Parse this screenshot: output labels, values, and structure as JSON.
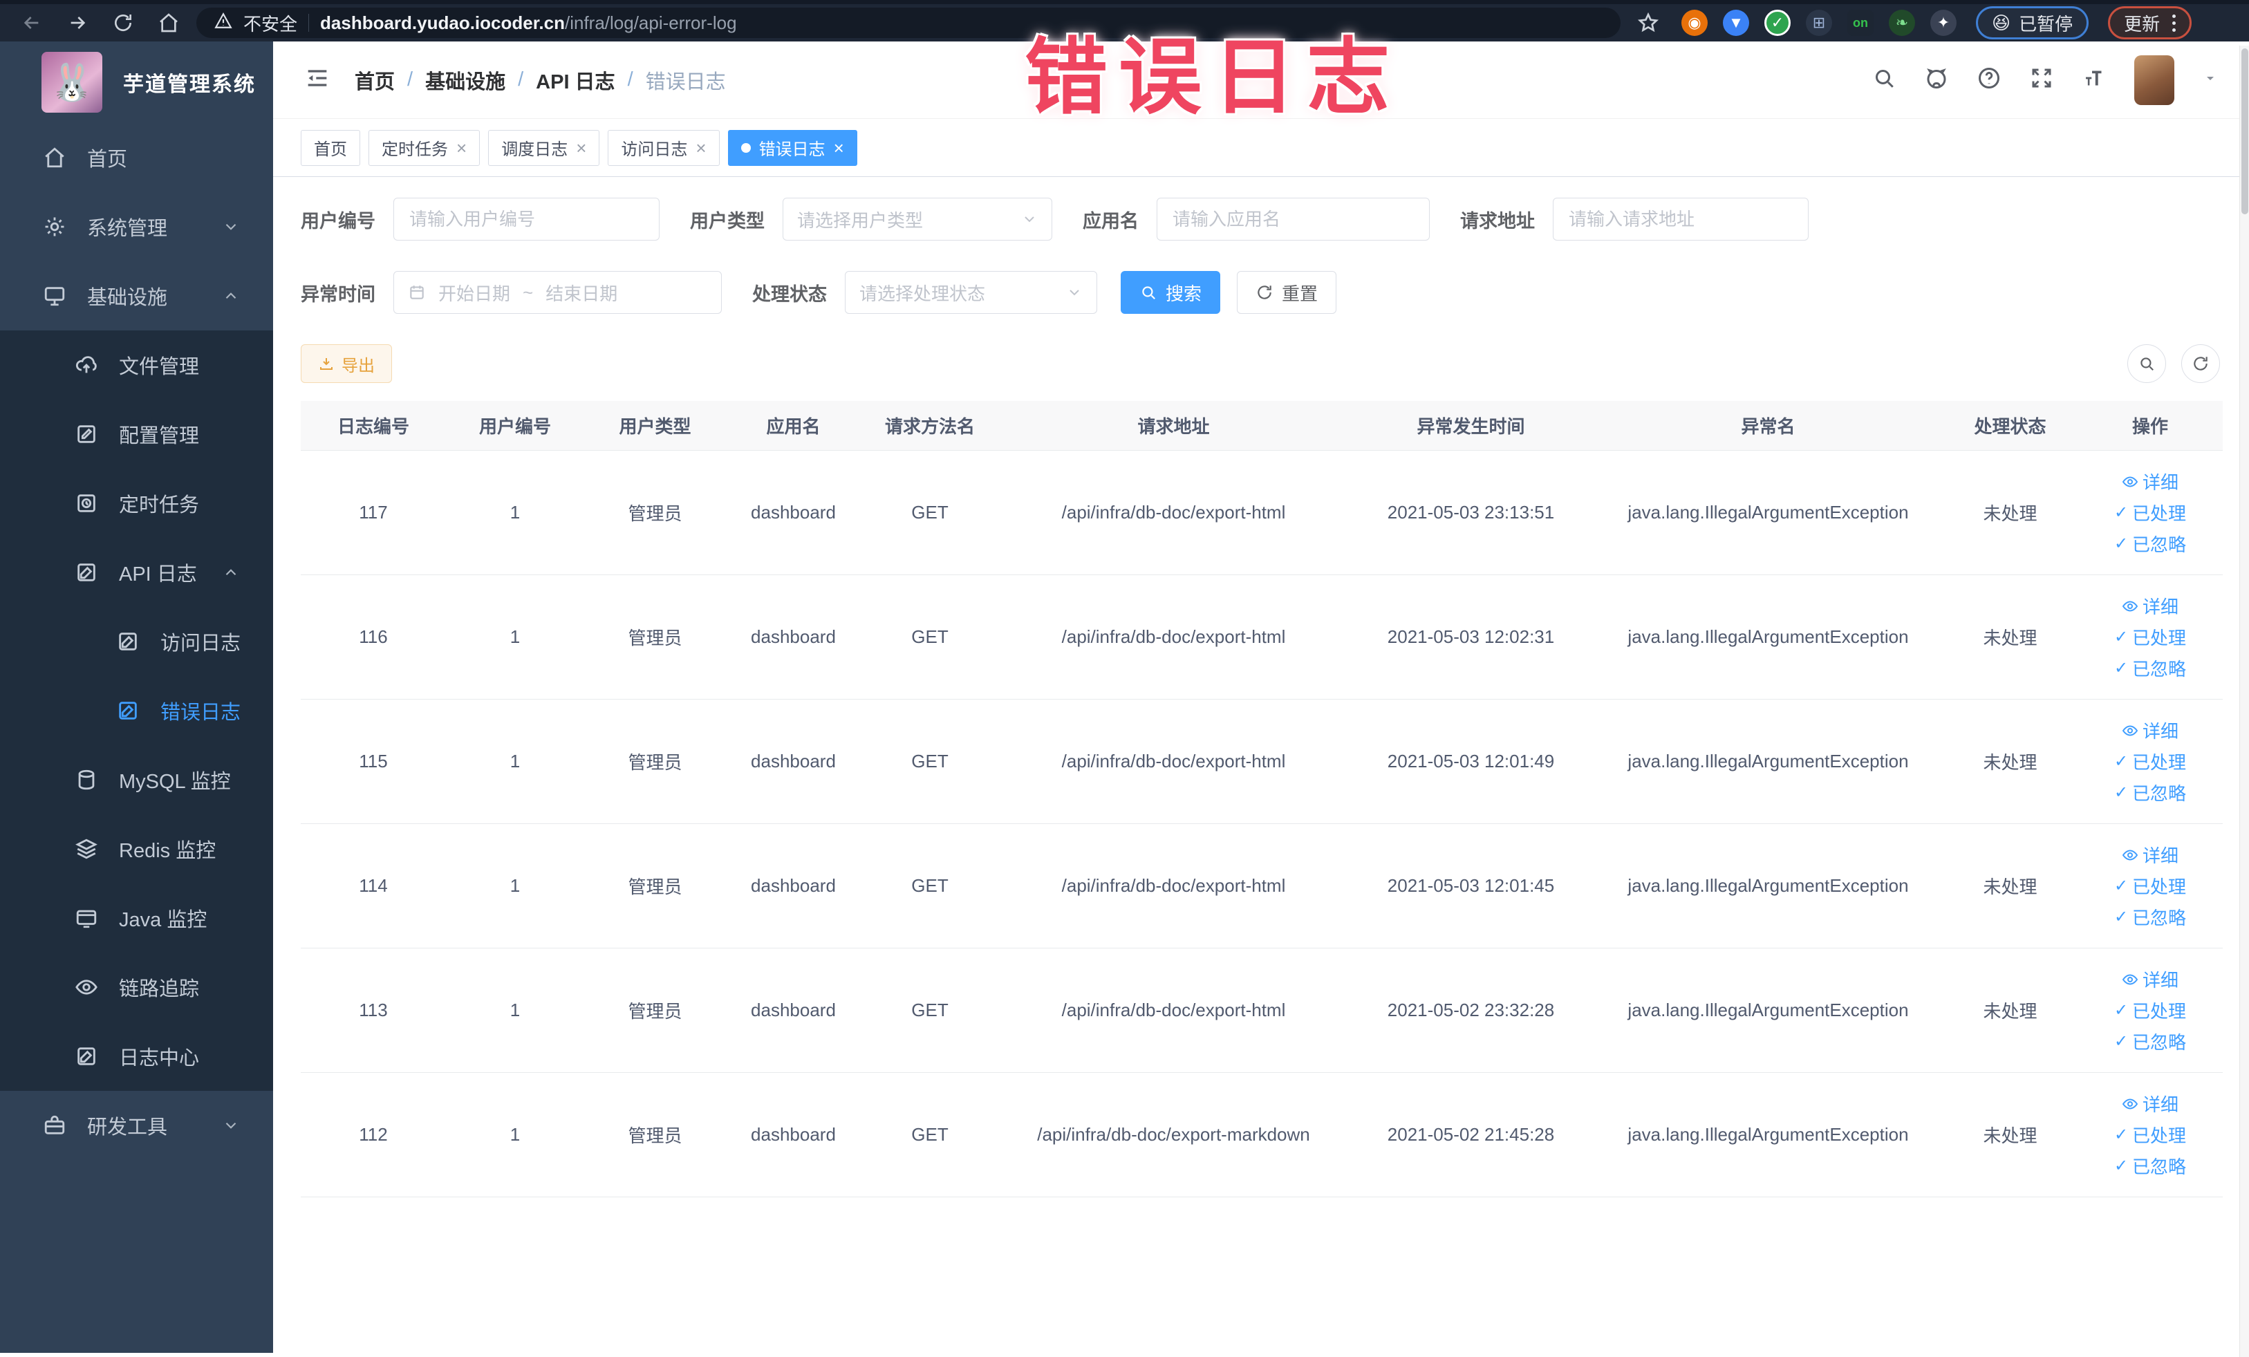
{
  "colors": {
    "accent": "#409eff",
    "sidebar_bg": "#304156",
    "submenu_bg": "#1f2d3d",
    "warning": "#e6a23c",
    "watermark_pink": "#ef4560"
  },
  "watermark": "错误日志",
  "browser": {
    "security_label": "不安全",
    "url_domain": "dashboard.yudao.iocoder.cn",
    "url_path": "/infra/log/api-error-log",
    "on_badge": "on",
    "paused_emoji": "😆",
    "paused_label": "已暂停",
    "update_label": "更新"
  },
  "sidebar": {
    "title": "芋道管理系统",
    "logo_emoji": "🐰",
    "items": [
      {
        "label": "首页"
      },
      {
        "label": "系统管理"
      },
      {
        "label": "基础设施"
      },
      {
        "label": "文件管理"
      },
      {
        "label": "配置管理"
      },
      {
        "label": "定时任务"
      },
      {
        "label": "API 日志"
      },
      {
        "label": "访问日志"
      },
      {
        "label": "错误日志"
      },
      {
        "label": "MySQL 监控"
      },
      {
        "label": "Redis 监控"
      },
      {
        "label": "Java 监控"
      },
      {
        "label": "链路追踪"
      },
      {
        "label": "日志中心"
      },
      {
        "label": "研发工具"
      }
    ]
  },
  "breadcrumb": {
    "separator": "/",
    "items": [
      "首页",
      "基础设施",
      "API 日志",
      "错误日志"
    ]
  },
  "tabs": [
    {
      "label": "首页"
    },
    {
      "label": "定时任务",
      "close": "×"
    },
    {
      "label": "调度日志",
      "close": "×"
    },
    {
      "label": "访问日志",
      "close": "×"
    },
    {
      "label": "错误日志",
      "close": "×",
      "active": true
    }
  ],
  "filters": {
    "user_id": {
      "label": "用户编号",
      "placeholder": "请输入用户编号"
    },
    "user_type": {
      "label": "用户类型",
      "placeholder": "请选择用户类型"
    },
    "app_name": {
      "label": "应用名",
      "placeholder": "请输入应用名"
    },
    "request_url": {
      "label": "请求地址",
      "placeholder": "请输入请求地址"
    },
    "exception_time": {
      "label": "异常时间",
      "start": "开始日期",
      "separator": "~",
      "end": "结束日期"
    },
    "process_status": {
      "label": "处理状态",
      "placeholder": "请选择处理状态"
    },
    "search": "搜索",
    "reset": "重置"
  },
  "toolbar": {
    "export": "导出"
  },
  "table": {
    "headers": [
      "日志编号",
      "用户编号",
      "用户类型",
      "应用名",
      "请求方法名",
      "请求地址",
      "异常发生时间",
      "异常名",
      "处理状态",
      "操作"
    ],
    "actions": {
      "detail": "详细",
      "processed": "已处理",
      "ignored": "已忽略"
    },
    "rows": [
      {
        "id": "117",
        "user_id": "1",
        "user_type": "管理员",
        "app": "dashboard",
        "method": "GET",
        "url": "/api/infra/db-doc/export-html",
        "time": "2021-05-03 23:13:51",
        "exception": "java.lang.IllegalArgumentException",
        "status": "未处理"
      },
      {
        "id": "116",
        "user_id": "1",
        "user_type": "管理员",
        "app": "dashboard",
        "method": "GET",
        "url": "/api/infra/db-doc/export-html",
        "time": "2021-05-03 12:02:31",
        "exception": "java.lang.IllegalArgumentException",
        "status": "未处理"
      },
      {
        "id": "115",
        "user_id": "1",
        "user_type": "管理员",
        "app": "dashboard",
        "method": "GET",
        "url": "/api/infra/db-doc/export-html",
        "time": "2021-05-03 12:01:49",
        "exception": "java.lang.IllegalArgumentException",
        "status": "未处理"
      },
      {
        "id": "114",
        "user_id": "1",
        "user_type": "管理员",
        "app": "dashboard",
        "method": "GET",
        "url": "/api/infra/db-doc/export-html",
        "time": "2021-05-03 12:01:45",
        "exception": "java.lang.IllegalArgumentException",
        "status": "未处理"
      },
      {
        "id": "113",
        "user_id": "1",
        "user_type": "管理员",
        "app": "dashboard",
        "method": "GET",
        "url": "/api/infra/db-doc/export-html",
        "time": "2021-05-02 23:32:28",
        "exception": "java.lang.IllegalArgumentException",
        "status": "未处理"
      },
      {
        "id": "112",
        "user_id": "1",
        "user_type": "管理员",
        "app": "dashboard",
        "method": "GET",
        "url": "/api/infra/db-doc/export-markdown",
        "time": "2021-05-02 21:45:28",
        "exception": "java.lang.IllegalArgumentException",
        "status": "未处理"
      }
    ]
  }
}
